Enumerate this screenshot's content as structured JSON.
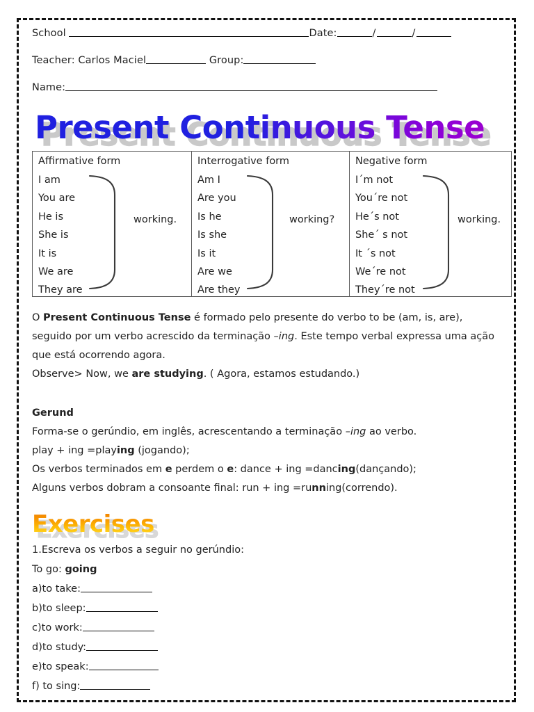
{
  "header": {
    "school_label": "School",
    "date_label": "Date:",
    "teacher_label": "Teacher:",
    "teacher_name": "Carlos Maciel",
    "group_label": "Group:",
    "name_label": "Name:"
  },
  "title": "Present Continuous Tense",
  "table": {
    "columns": [
      {
        "heading": "Affirmative form",
        "pronouns": [
          "I am",
          "You are",
          "He is",
          "She is",
          "It is",
          "We are",
          "They are"
        ],
        "verb": "working."
      },
      {
        "heading": "Interrogative form",
        "pronouns": [
          "Am I",
          "Are you",
          "Is he",
          "Is she",
          "Is it",
          "Are we",
          "Are they"
        ],
        "verb": "working?"
      },
      {
        "heading": "Negative form",
        "pronouns": [
          "I´m not",
          "You´re not",
          "He´s not",
          "She´ s  not",
          "It ´s not",
          "We´re not",
          "They´re not"
        ],
        "verb": "working."
      }
    ]
  },
  "intro": {
    "p1_a": "O ",
    "p1_bold": "Present Continuous Tense",
    "p1_b": " é formado pelo presente do verbo to be (am, is, are), seguido por um verbo acrescido da terminação ",
    "p1_italic": "–ing",
    "p1_c": ". Este tempo verbal expressa uma ação que está ocorrendo agora.",
    "observe_a": "Observe> Now, we ",
    "observe_bold": "are studying",
    "observe_b": ". ( Agora, estamos estudando.)"
  },
  "gerund": {
    "heading": "Gerund",
    "line1_a": "Forma-se o gerúndio, em inglês, acrescentando a terminação ",
    "line1_italic": "–ing",
    "line1_b": " ao verbo.",
    "line2_a": "play + ing =play",
    "line2_bold": "ing",
    "line2_b": " (jogando);",
    "line3_a": "Os verbos terminados em ",
    "line3_bold1": "e",
    "line3_b": " perdem o ",
    "line3_bold2": "e",
    "line3_c": ": dance + ing =danc",
    "line3_bold3": "ing",
    "line3_d": "(dançando);",
    "line4_a": "Alguns verbos dobram a consoante final: run + ing =ru",
    "line4_bold": "nn",
    "line4_b": "ing(correndo)."
  },
  "exercises": {
    "heading": "Exercises",
    "prompt": "1.Escreva os verbos a seguir no gerúndio:",
    "model_label": "To go: ",
    "model_answer": "going",
    "items": [
      {
        "label": "a)to take:",
        "blank_width": 103
      },
      {
        "label": "b)to sleep:",
        "blank_width": 103
      },
      {
        "label": "c)to work:",
        "blank_width": 103
      },
      {
        "label": "d)to study:",
        "blank_width": 103
      },
      {
        "label": "e)to speak:",
        "blank_width": 100
      },
      {
        "label": "f) to sing:",
        "blank_width": 101
      }
    ]
  },
  "colors": {
    "title_start": "#2020e0",
    "title_end": "#8b00d8",
    "title_shadow": "#c9c9c9",
    "exercises_start": "#ef7c00",
    "exercises_end": "#ffe870",
    "exercises_shadow": "#d8d8d8",
    "border": "#111111",
    "table_border": "#5b5b5b"
  }
}
